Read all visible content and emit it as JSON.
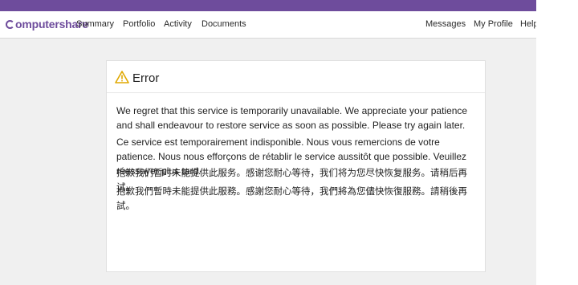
{
  "nav": {
    "logo": "omputershare",
    "items": [
      "Summary",
      "Portfolio",
      "Activity",
      "Documents"
    ],
    "right_items": [
      "Messages",
      "My Profile",
      "Help"
    ]
  },
  "error_card": {
    "title": "Error",
    "icon": "warning-triangle-icon",
    "messages": [
      "We regret that this service is temporarily unavailable. We appreciate your patience and shall endeavour to restore service as soon as possible. Please try again later.",
      "Ce service est temporairement indisponible. Nous vous remercions de votre patience. Nous nous efforçons de rétablir le service aussitôt que possible. Veuillez réessayer plus tard.",
      "抱歉我们暂时未能提供此服务。感谢您耐心等待，我们将为您尽快恢复服务。请稍后再试。",
      "抱歉我們暫時未能提供此服務。感謝您耐心等待，我們將為您儘快恢復服務。請稍後再試。"
    ]
  },
  "colors": {
    "brand": "#6e4c9c",
    "warning": "#e0a800",
    "page_bg": "#f0f0f0"
  }
}
